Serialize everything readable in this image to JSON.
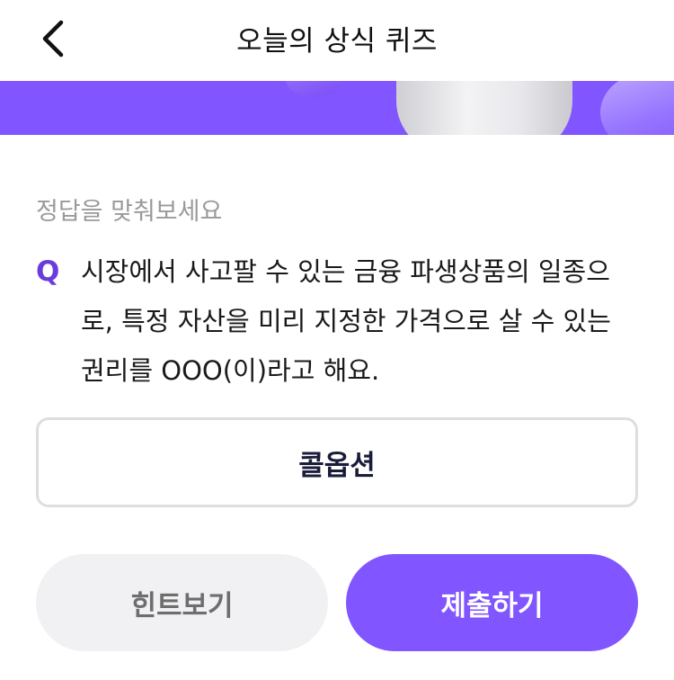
{
  "header": {
    "title": "오늘의 상식 퀴즈",
    "back_icon": "chevron-left-icon"
  },
  "quiz": {
    "prompt": "정답을 맞춰보세요",
    "q_label": "Q",
    "question_lines": [
      "시장에서 사고팔 수 있는 금융 파생상품의 일종으",
      "로, 특정 자산을 미리 지정한 가격으로 살 수 있는",
      "권리를 OOO(이)라고 해요."
    ],
    "answer_value": "콜옵션"
  },
  "actions": {
    "hint_label": "힌트보기",
    "submit_label": "제출하기"
  },
  "colors": {
    "accent": "#8155ff",
    "q_mark": "#6a3cdc",
    "hint_bg": "#f1f1f3"
  }
}
